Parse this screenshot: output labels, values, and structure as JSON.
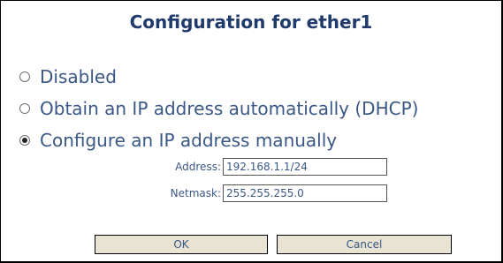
{
  "dialog": {
    "title": "Configuration for ether1"
  },
  "options": [
    {
      "label": "Disabled",
      "checked": false
    },
    {
      "label": "Obtain an IP address automatically (DHCP)",
      "checked": false
    },
    {
      "label": "Configure an IP address manually",
      "checked": true
    }
  ],
  "fields": {
    "address": {
      "label": "Address:",
      "value": "192.168.1.1/24"
    },
    "netmask": {
      "label": "Netmask:",
      "value": "255.255.255.0"
    }
  },
  "buttons": {
    "ok_label": "OK",
    "cancel_label": "Cancel"
  },
  "colors": {
    "title": "#1f3a6b",
    "text": "#3a5786",
    "button_bg": "#e8e3d2",
    "border": "#000000"
  }
}
